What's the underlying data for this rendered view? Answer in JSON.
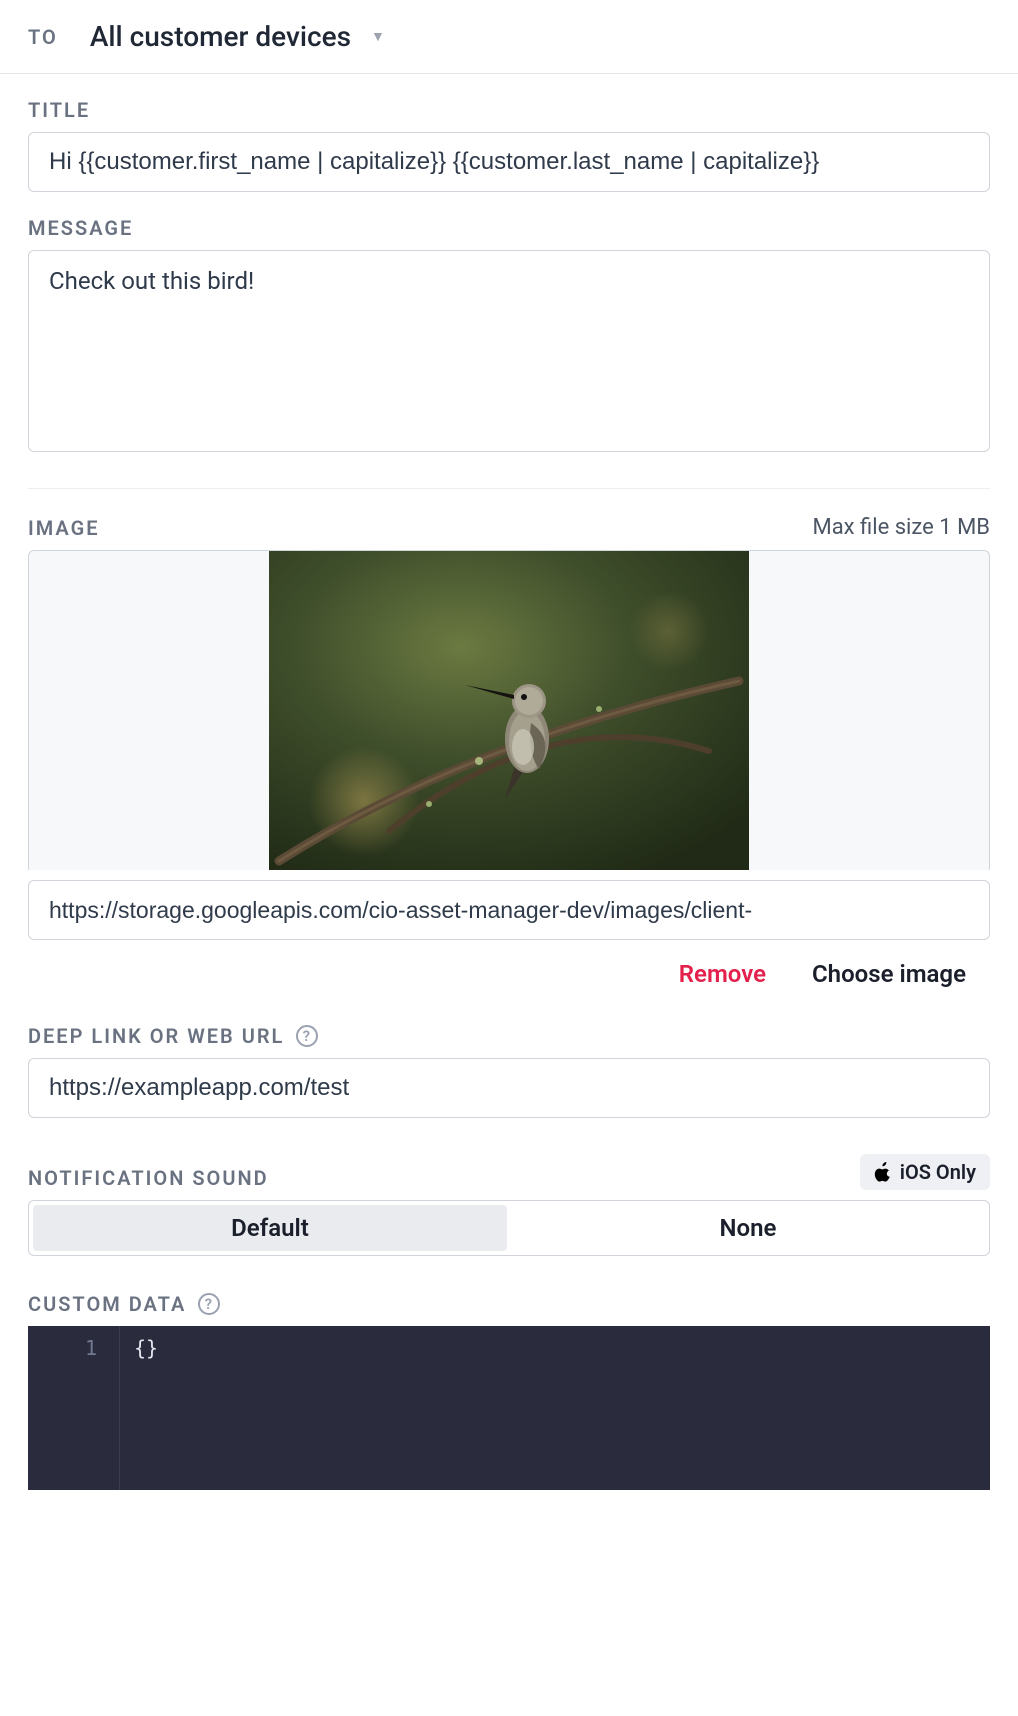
{
  "to": {
    "label": "TO",
    "value": "All customer devices"
  },
  "title": {
    "label": "TITLE",
    "value": "Hi {{customer.first_name | capitalize}} {{customer.last_name | capitalize}}"
  },
  "message": {
    "label": "MESSAGE",
    "value": "Check out this bird!"
  },
  "image": {
    "label": "IMAGE",
    "max_size": "Max file size 1 MB",
    "url": "https://storage.googleapis.com/cio-asset-manager-dev/images/client-",
    "preview_alt": "hummingbird on branch",
    "remove": "Remove",
    "choose": "Choose image"
  },
  "deeplink": {
    "label": "DEEP LINK OR WEB URL",
    "value": "https://exampleapp.com/test"
  },
  "sound": {
    "label": "NOTIFICATION SOUND",
    "ios_badge": "iOS Only",
    "options": {
      "default": "Default",
      "none": "None"
    },
    "selected": "default"
  },
  "custom_data": {
    "label": "CUSTOM DATA",
    "line_number": "1",
    "content": "{}"
  }
}
